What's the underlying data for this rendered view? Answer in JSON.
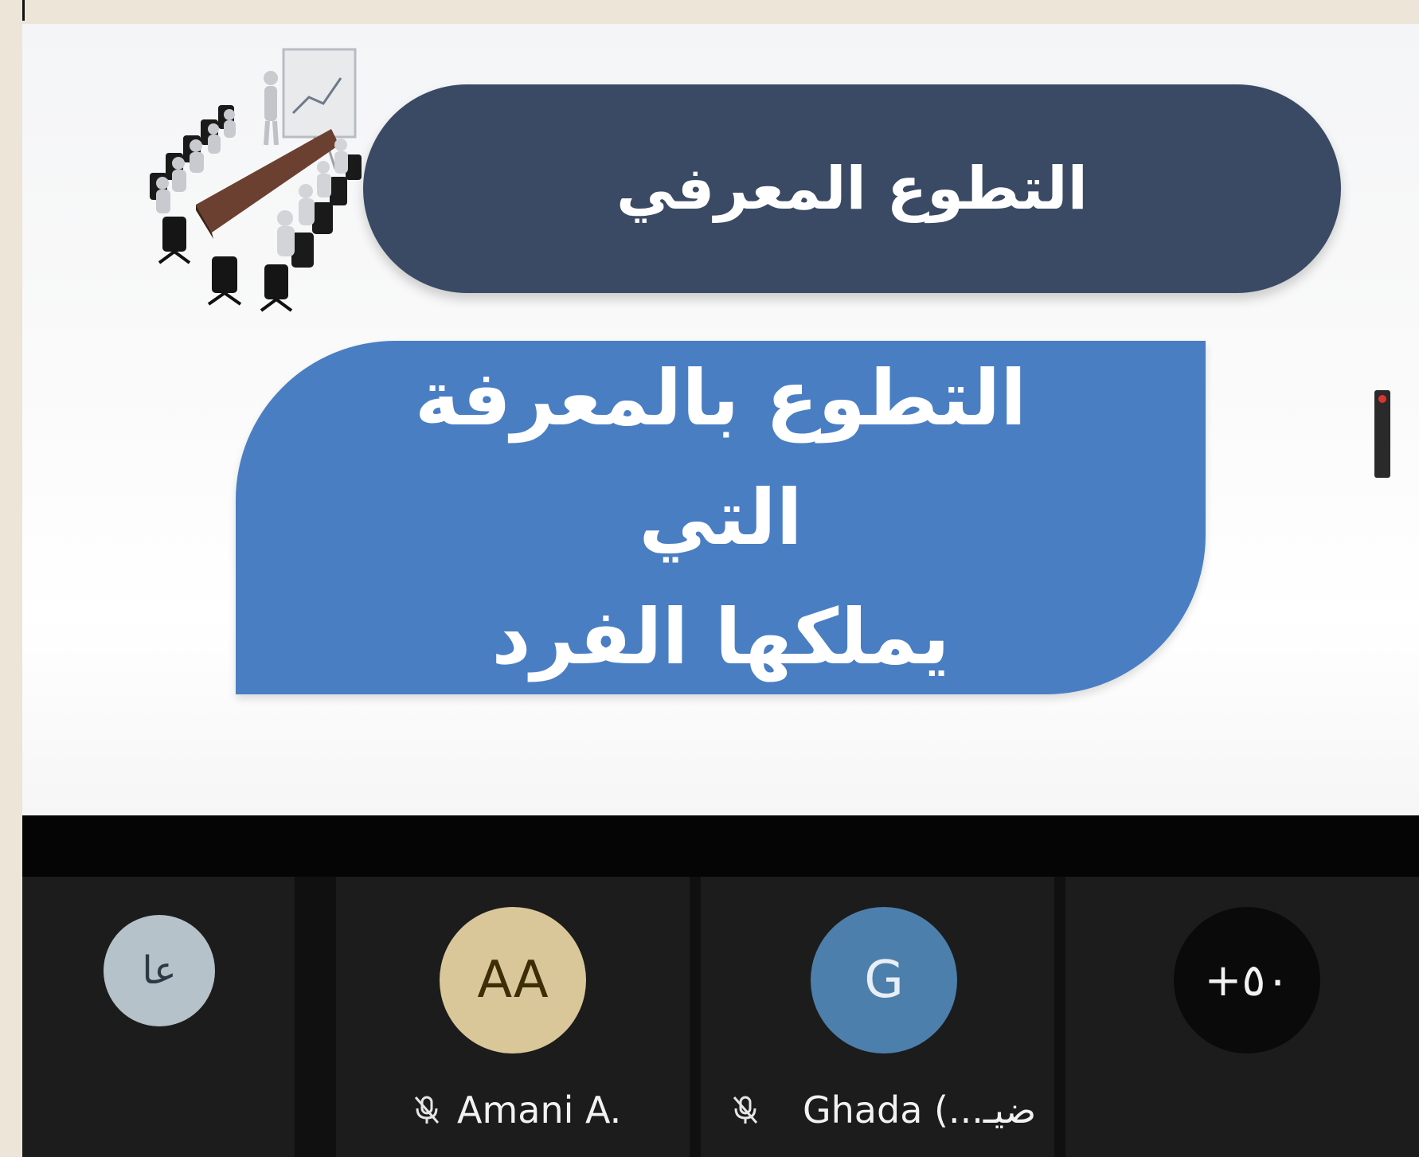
{
  "slide": {
    "title": "التطوع المعرفي",
    "body_line1": "التطوع بالمعرفة التي",
    "body_line2": "يملكها الفرد",
    "colors": {
      "title_pill": "#3a4a64",
      "body_card": "#4a7ec3",
      "text": "#ffffff"
    }
  },
  "participants": [
    {
      "initials": "عا",
      "name": "",
      "muted": false,
      "avatar_color": "#b5c2c9",
      "initials_color": "#2a3a44"
    },
    {
      "initials": "AA",
      "name": "Amani A.",
      "muted": true,
      "avatar_color": "#d9c79a",
      "initials_color": "#3d2e08"
    },
    {
      "initials": "G",
      "name": "Ghada (...ضيـ",
      "muted": true,
      "avatar_color": "#4d7fac",
      "initials_color": "#e8eef5"
    },
    {
      "initials": "+٥٠",
      "name": "",
      "muted": false,
      "avatar_color": "#0a0a0a",
      "initials_color": "#f2f2f2"
    }
  ],
  "icons": {
    "mic": "mic-off-icon",
    "illustration": "meeting-room-illustration"
  },
  "theme": {
    "strip_bg": "#1c1c1c",
    "band_bg": "#050505",
    "frame_bg": "#ece5d8"
  }
}
